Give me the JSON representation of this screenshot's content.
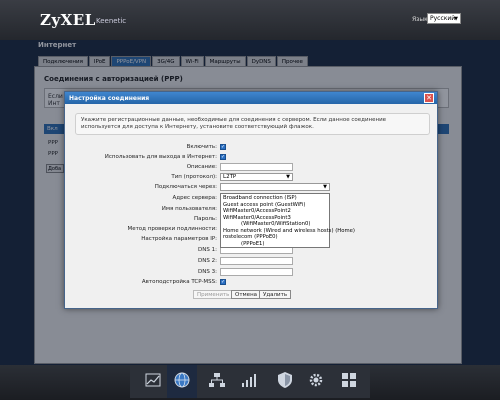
{
  "header": {
    "logo": "ZyXEL",
    "model": "Keenetic",
    "lang_label": "Язык:",
    "lang_value": "Русский"
  },
  "page": {
    "title": "Интернет"
  },
  "tabs": [
    {
      "label": "Подключения"
    },
    {
      "label": "IPoE"
    },
    {
      "label": "PPPoE/VPN",
      "active": true
    },
    {
      "label": "3G/4G"
    },
    {
      "label": "Wi-Fi"
    },
    {
      "label": "Маршруты"
    },
    {
      "label": "DyDNS"
    },
    {
      "label": "Прочее"
    }
  ],
  "panel": {
    "title": "Соединения с авторизацией (PPP)",
    "info_fragment": "Если",
    "info_fragment2": "Инт",
    "table_header_fragment": "Вкл",
    "rows": [
      "PPP",
      "PPP"
    ],
    "add_btn": "Доба"
  },
  "modal": {
    "title": "Настройка соединения",
    "close": "✕",
    "info": "Укажите регистрационные данные, необходимые для соединения с сервером. Если данное соединение используется для доступа к Интернету, установите соответствующий флажок.",
    "labels": {
      "enable": "Включить:",
      "use_internet": "Использовать для выхода в Интернет:",
      "description": "Описание:",
      "protocol": "Тип (протокол):",
      "via": "Подключаться через:",
      "server": "Адрес сервера:",
      "username": "Имя пользователя:",
      "password": "Пароль:",
      "auth": "Метод проверки подлинности:",
      "ip": "Настройка параметров IP:",
      "dns1": "DNS 1:",
      "dns2": "DNS 2:",
      "dns3": "DNS 3:",
      "tcp_mss": "Автоподстройка TCP-MSS:"
    },
    "protocol_value": "L2TP",
    "via_value": "",
    "dropdown": [
      "Broadband connection (ISP)",
      "Guest access point (GuestWiFi)",
      "WifiMaster0/AccessPoint2",
      "WifiMaster0/AccessPoint3",
      "(WifiMaster0/WifiStation0)",
      "Home network (Wired and wireless hosts) (Home)",
      "rostelecom (PPPoE0)",
      "(PPPoE1)"
    ],
    "buttons": {
      "apply": "Применить",
      "cancel": "Отмена",
      "delete": "Удалить"
    }
  },
  "dock": {
    "icons": [
      "chart-icon",
      "globe-icon",
      "network-icon",
      "signal-icon",
      "shield-icon",
      "gear-icon",
      "apps-icon"
    ]
  }
}
